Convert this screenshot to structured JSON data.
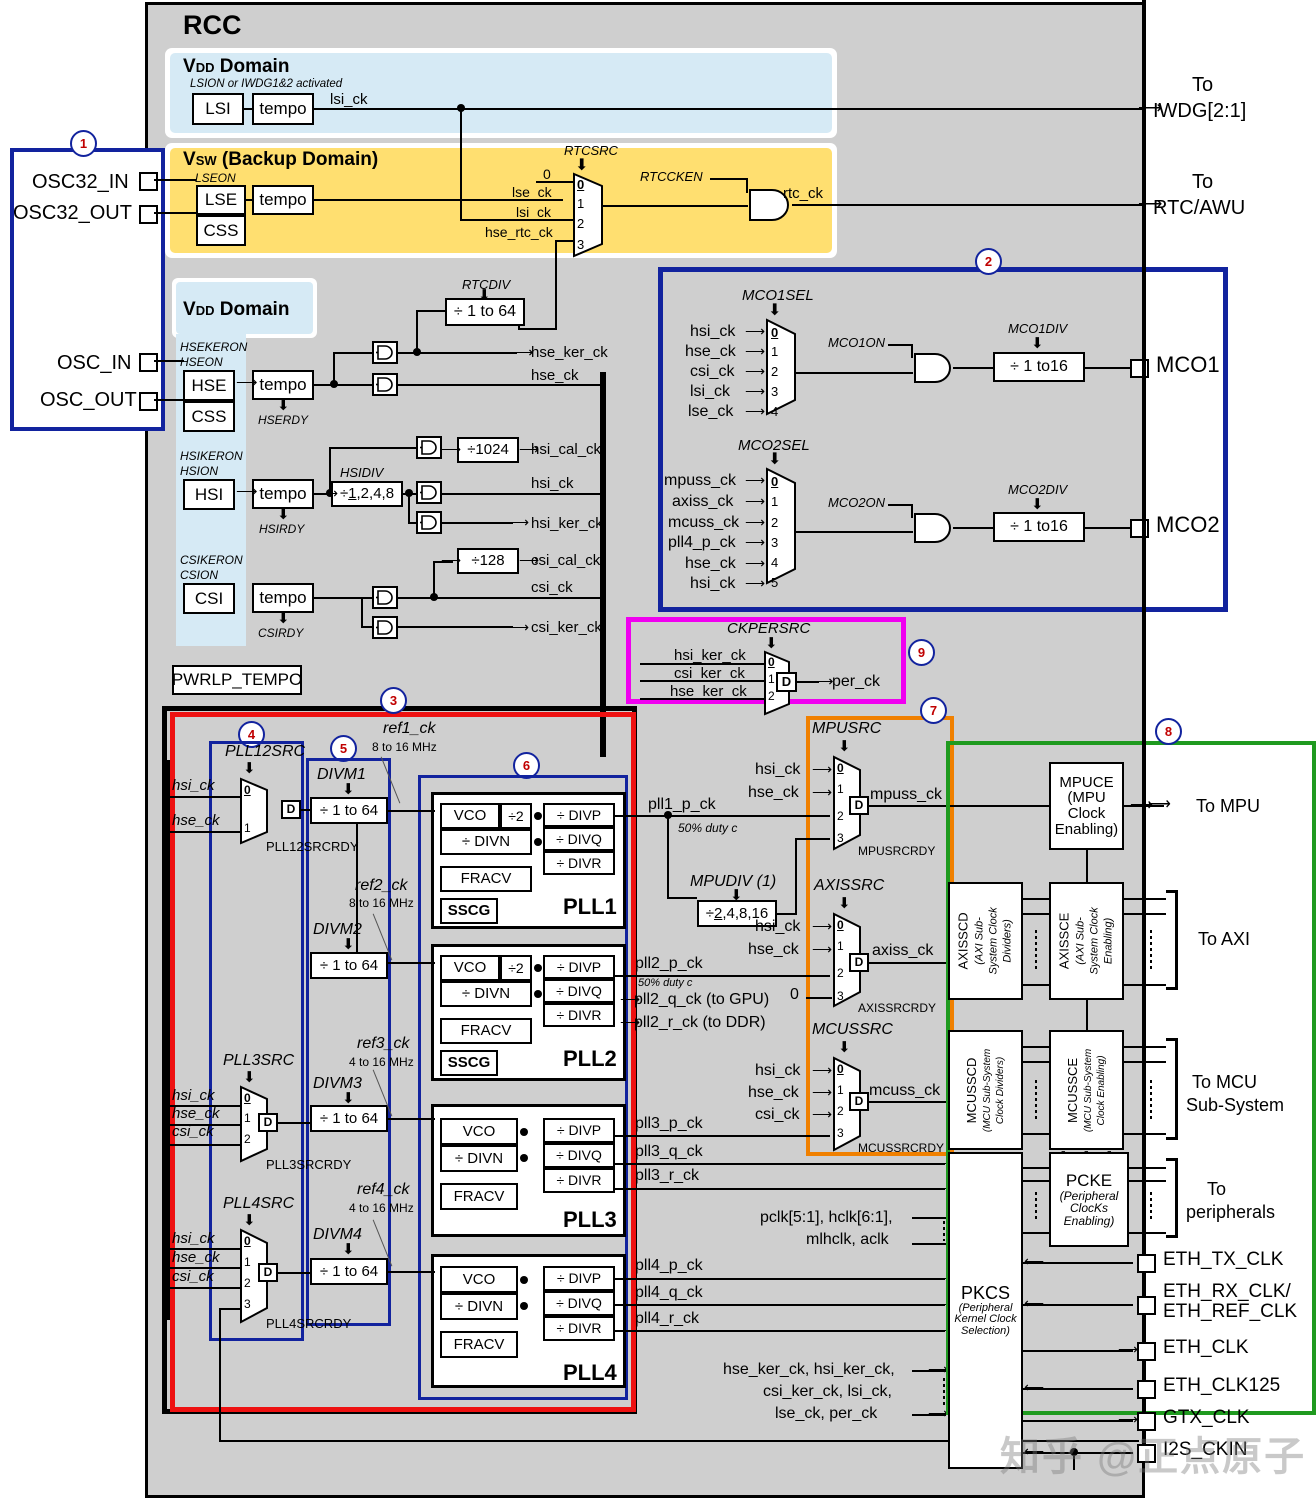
{
  "diagram": {
    "title": "RCC",
    "watermark": "知乎 @正点原子"
  },
  "domains": {
    "vdd1": {
      "label_v": "V",
      "label_sub": "DD",
      "label_rest": " Domain",
      "note": "LSION or IWDG1&2 activated",
      "lsi": "LSI",
      "tempo": "tempo",
      "out": "lsi_ck"
    },
    "vsw": {
      "label_v": "V",
      "label_sub": "SW",
      "label_rest": " (Backup Domain)",
      "lseon": "LSEON",
      "lse": "LSE",
      "css": "CSS",
      "tempo": "tempo",
      "rtcsrc": "RTCSRC",
      "rtccken": "RTCCKEN",
      "rtc_ck": "rtc_ck",
      "mux_inputs": [
        "0",
        "lse_ck",
        "lsi_ck",
        "hse_rtc_ck"
      ],
      "mux_idx": [
        "0",
        "1",
        "2",
        "3"
      ]
    },
    "vdd2": {
      "label_v": "V",
      "label_sub": "DD",
      "label_rest": " Domain",
      "hsekeron": "HSEKERON",
      "hseon": "HSEON",
      "hse": "HSE",
      "css": "CSS",
      "hserdy": "HSERDY",
      "hsikeron": "HSIKERON",
      "hsion": "HSION",
      "hsi": "HSI",
      "hsirdy": "HSIRDY",
      "hsidiv": "HSIDIV",
      "hsidiv_box": "÷1,2,4,8",
      "csikeron": "CSIKERON",
      "csion": "CSION",
      "csi": "CSI",
      "csirdy": "CSIRDY",
      "tempo": "tempo",
      "rtcdiv": "RTCDIV",
      "rtcdiv_box": "÷ 1 to 64",
      "div1024": "÷1024",
      "div128": "÷128",
      "pwrlp": "PWRLP_TEMPO",
      "outputs": [
        "hse_ker_ck",
        "hse_ck",
        "hsi_cal_ck",
        "hsi_ck",
        "hsi_ker_ck",
        "csi_cal_ck",
        "csi_ck",
        "csi_ker_ck"
      ]
    }
  },
  "pins": {
    "osc32_in": "OSC32_IN",
    "osc32_out": "OSC32_OUT",
    "osc_in": "OSC_IN",
    "osc_out": "OSC_OUT",
    "mco1": "MCO1",
    "mco2": "MCO2",
    "eth_tx_clk": "ETH_TX_CLK",
    "eth_rx_clk": "ETH_RX_CLK/",
    "eth_ref_clk": "ETH_REF_CLK",
    "eth_clk": "ETH_CLK",
    "eth_clk125": "ETH_CLK125",
    "gtx_clk": "GTX_CLK",
    "i2s_ckin": "I2S_CKIN"
  },
  "dests": {
    "to_iwdg_l1": "To",
    "to_iwdg_l2": "IWDG[2:1]",
    "to_rtc_l1": "To",
    "to_rtc_l2": "RTC/AWU",
    "to_mpu": "To MPU",
    "to_axi": "To AXI",
    "to_mcu_l1": "To MCU",
    "to_mcu_l2": "Sub-System",
    "to_periph_l1": "To",
    "to_periph_l2": "peripherals"
  },
  "mco": {
    "mco1sel": "MCO1SEL",
    "mco1_inputs": [
      "hsi_ck",
      "hse_ck",
      "csi_ck",
      "lsi_ck",
      "lse_ck"
    ],
    "mco1_idx": [
      "0",
      "1",
      "2",
      "3",
      "4"
    ],
    "mco1on": "MCO1ON",
    "mco1div": "MCO1DIV",
    "mco1div_box": "÷ 1 to16",
    "mco2sel": "MCO2SEL",
    "mco2_inputs": [
      "mpuss_ck",
      "axiss_ck",
      "mcuss_ck",
      "pll4_p_ck",
      "hse_ck",
      "hsi_ck"
    ],
    "mco2_idx": [
      "0",
      "1",
      "2",
      "3",
      "4",
      "5"
    ],
    "mco2on": "MCO2ON",
    "mco2div": "MCO2DIV",
    "mco2div_box": "÷ 1 to16"
  },
  "ckper": {
    "label": "CKPERSRC",
    "inputs": [
      "hsi_ker_ck",
      "csi_ker_ck",
      "hse_ker_ck"
    ],
    "idx": [
      "0",
      "1",
      "2"
    ],
    "out": "per_ck",
    "d": "D"
  },
  "pll": {
    "pll12src": "PLL12SRC",
    "pll12src_inputs": [
      "hsi_ck",
      "hse_ck"
    ],
    "pll12src_idx": [
      "0",
      "1"
    ],
    "pll12srcrdy": "PLL12SRCRDY",
    "pll3src": "PLL3SRC",
    "pll3src_inputs": [
      "hsi_ck",
      "hse_ck",
      "csi_ck"
    ],
    "pll3src_idx": [
      "0",
      "1",
      "2"
    ],
    "pll3srcrdy": "PLL3SRCRDY",
    "pll4src": "PLL4SRC",
    "pll4src_inputs": [
      "hsi_ck",
      "hse_ck",
      "csi_ck"
    ],
    "pll4src_idx": [
      "0",
      "1",
      "2",
      "3"
    ],
    "pll4srcrdy": "PLL4SRCRDY",
    "divm1": "DIVM1",
    "divm2": "DIVM2",
    "divm3": "DIVM3",
    "divm4": "DIVM4",
    "divbox": "÷ 1 to 64",
    "ref1": "ref1_ck",
    "ref1_rng": "8 to 16 MHz",
    "ref2": "ref2_ck",
    "ref2_rng": "8 to 16 MHz",
    "ref3": "ref3_ck",
    "ref3_rng": "4 to 16 MHz",
    "ref4": "ref4_ck",
    "ref4_rng": "4 to 16 MHz",
    "vco": "VCO",
    "div2": "÷2",
    "divn": "÷ DIVN",
    "fracv": "FRACV",
    "sscg": "SSCG",
    "divp": "÷ DIVP",
    "divq": "÷ DIVQ",
    "divr": "÷ DIVR",
    "names": [
      "PLL1",
      "PLL2",
      "PLL3",
      "PLL4"
    ],
    "d": "D"
  },
  "pll_outputs": {
    "pll1_p": "pll1_p_ck",
    "duty1": "50% duty c",
    "mpudiv": "MPUDIV (1)",
    "mpudiv_box": "÷2,4,8,16",
    "pll2_p": "pll2_p_ck",
    "duty2": "50% duty c",
    "pll2_q": "pll2_q_ck (to GPU)",
    "pll2_r": "pll2_r_ck (to DDR)",
    "pll3_p": "pll3_p_ck",
    "pll3_q": "pll3_q_ck",
    "pll3_r": "pll3_r_ck",
    "pll4_p": "pll4_p_ck",
    "pll4_q": "pll4_q_ck",
    "pll4_r": "pll4_r_ck"
  },
  "sysmux": {
    "mpusrc": "MPUSRC",
    "mpusrc_inputs": [
      "hsi_ck",
      "hse_ck"
    ],
    "mpusrc_idx": [
      "0",
      "1",
      "2",
      "3"
    ],
    "mpuss_ck": "mpuss_ck",
    "mpusrcrdy": "MPUSRCRDY",
    "axissrc": "AXISSRC",
    "axissrc_inputs": [
      "hsi_ck",
      "hse_ck"
    ],
    "axissrc_idx": [
      "0",
      "1",
      "2",
      "3"
    ],
    "axiss_ck": "axiss_ck",
    "axissrcrdy": "AXISSRCRDY",
    "axis_zero": "0",
    "mcussrc": "MCUSSRC",
    "mcussrc_inputs": [
      "hsi_ck",
      "hse_ck",
      "csi_ck"
    ],
    "mcussrc_idx": [
      "0",
      "1",
      "2",
      "3"
    ],
    "mcuss_ck": "mcuss_ck",
    "mcussrcrdy": "MCUSSRCRDY",
    "d": "D"
  },
  "blocks": {
    "mpuce": [
      "MPUCE",
      "(MPU",
      "Clock",
      "Enabling)"
    ],
    "axisscd": [
      "AXISSCD",
      "(AXI Sub-",
      "System Clock",
      "Dividers)"
    ],
    "axissce": [
      "AXISSCE",
      "(AXI Sub-",
      "System Clock",
      "Enabling)"
    ],
    "mcusscd": [
      "MCUSSCD",
      "(MCU Sub-System",
      "Clock Dividers)"
    ],
    "mcussce": [
      "MCUSSCE",
      "(MCU Sub-System",
      "Clock Enabling)"
    ],
    "pcke": [
      "PCKE",
      "(Peripheral",
      "ClocKs",
      "Enabling)"
    ],
    "pkcs": [
      "PKCS",
      "(Peripheral",
      "Kernel Clock",
      "Selection)"
    ]
  },
  "bus_labels": {
    "pclk_l1": "pclk[5:1], hclk[6:1],",
    "pclk_l2": "mlhclk, aclk",
    "ker_l1": "hse_ker_ck, hsi_ker_ck,",
    "ker_l2": "csi_ker_ck, lsi_ck,",
    "ker_l3": "lse_ck,  per_ck"
  },
  "markers": [
    "1",
    "2",
    "3",
    "4",
    "5",
    "6",
    "7",
    "8",
    "9"
  ],
  "colors": {
    "gray": "#cfcfcf",
    "blue_domain": "#d6eaf5",
    "yellow_domain": "#ffdf70",
    "blue_frame": "#12239e",
    "red_frame": "#ee1111",
    "orange_frame": "#f08000",
    "green_frame": "#1f9a1f",
    "magenta_frame": "#f000f0",
    "marker_ring": "#12239e",
    "marker_text": "#c00000"
  }
}
